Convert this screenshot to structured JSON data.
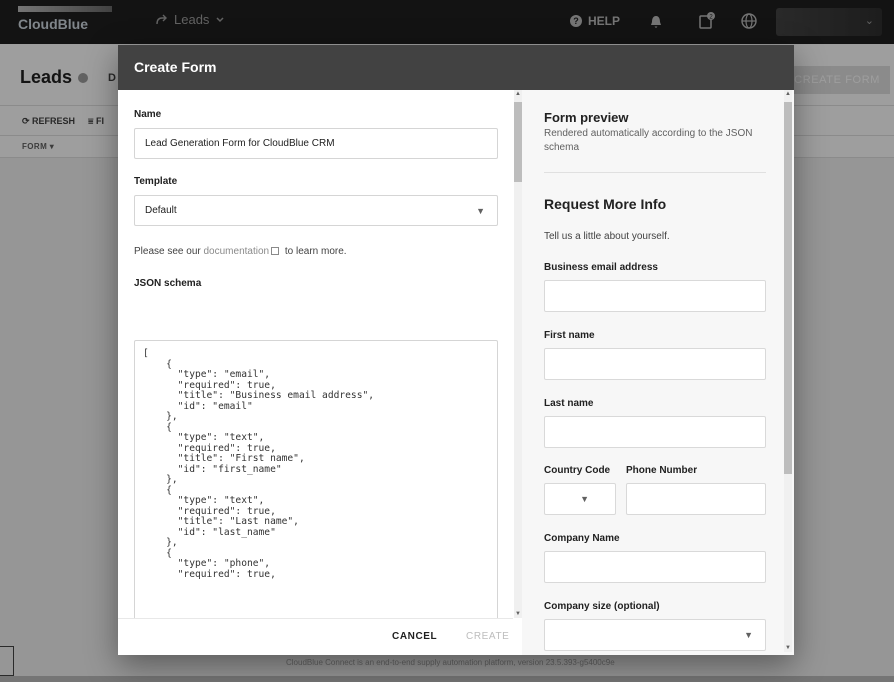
{
  "topbar": {
    "logo_text": "CloudBlue",
    "nav_label": "Leads",
    "help_label": "HELP",
    "tasks_count": "2"
  },
  "appbar": {
    "title": "Leads",
    "tab_partial": "D",
    "create_button": "CREATE FORM"
  },
  "toolbar": {
    "refresh": "REFRESH",
    "filter_partial": "FI"
  },
  "table": {
    "column_form": "FORM"
  },
  "footer": {
    "text": "CloudBlue Connect is an end-to-end supply automation platform, version 23.5.393-g5400c9e"
  },
  "dialog": {
    "title": "Create Form",
    "name_label": "Name",
    "name_value": "Lead Generation Form for CloudBlue CRM",
    "template_label": "Template",
    "template_value": "Default",
    "help_prefix": "Please see our ",
    "help_link": "documentation",
    "help_suffix": " to learn more.",
    "json_label": "JSON schema",
    "json_text": "[\n    {\n      \"type\": \"email\",\n      \"required\": true,\n      \"title\": \"Business email address\",\n      \"id\": \"email\"\n    },\n    {\n      \"type\": \"text\",\n      \"required\": true,\n      \"title\": \"First name\",\n      \"id\": \"first_name\"\n    },\n    {\n      \"type\": \"text\",\n      \"required\": true,\n      \"title\": \"Last name\",\n      \"id\": \"last_name\"\n    },\n    {\n      \"type\": \"phone\",\n      \"required\": true,",
    "cancel_button": "CANCEL",
    "create_button": "CREATE"
  },
  "preview": {
    "title": "Form preview",
    "subtitle": "Rendered automatically according to the JSON schema",
    "form_title": "Request More Info",
    "form_desc": "Tell us a little about yourself.",
    "fields": {
      "email": "Business email address",
      "first_name": "First name",
      "last_name": "Last name",
      "country_code": "Country Code",
      "phone_number": "Phone Number",
      "company_name": "Company Name",
      "company_size": "Company size (optional)"
    }
  },
  "colors": {
    "topbar": "#1f1f1f",
    "dialog_header": "#424242",
    "preview_bg": "#f7f7f7"
  }
}
